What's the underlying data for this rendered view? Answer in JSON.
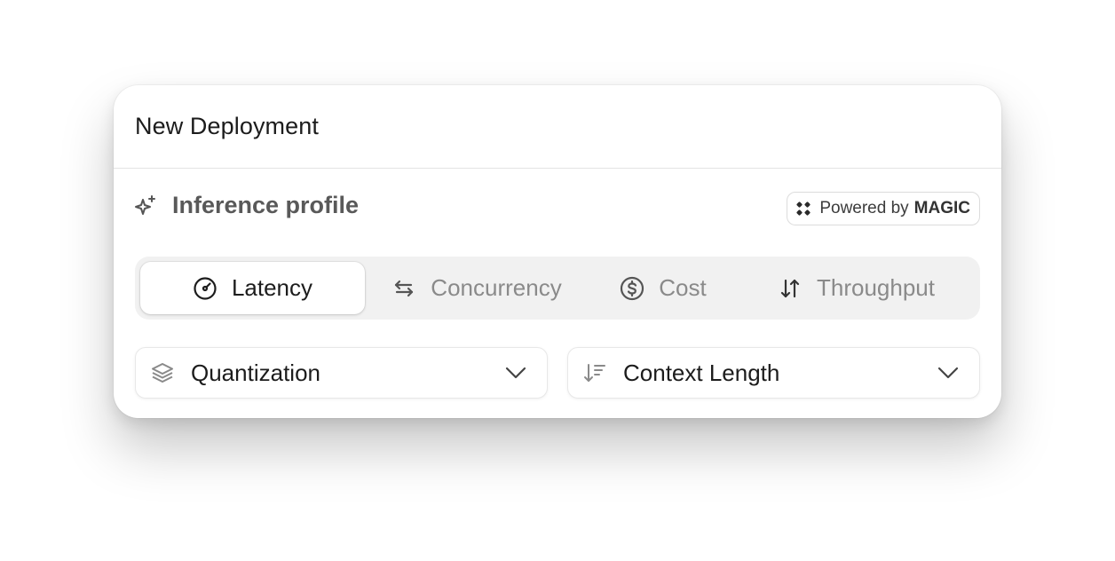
{
  "dialog": {
    "title": "New Deployment"
  },
  "section": {
    "title": "Inference profile",
    "icon": "sparkle-icon"
  },
  "badge": {
    "prefix": "Powered by",
    "brand": "MAGIC",
    "icon": "magic-logo-icon"
  },
  "tabs": [
    {
      "label": "Latency",
      "icon": "gauge-icon",
      "active": true
    },
    {
      "label": "Concurrency",
      "icon": "arrows-left-right-icon",
      "active": false
    },
    {
      "label": "Cost",
      "icon": "dollar-circle-icon",
      "active": false
    },
    {
      "label": "Throughput",
      "icon": "arrows-up-down-icon",
      "active": false
    }
  ],
  "dropdowns": [
    {
      "label": "Quantization",
      "icon": "layers-icon"
    },
    {
      "label": "Context Length",
      "icon": "sort-descending-icon"
    }
  ],
  "colors": {
    "active_text": "#1d1d1d",
    "inactive_text": "#8a8a8a",
    "segment_bg": "#f1f1f1"
  }
}
